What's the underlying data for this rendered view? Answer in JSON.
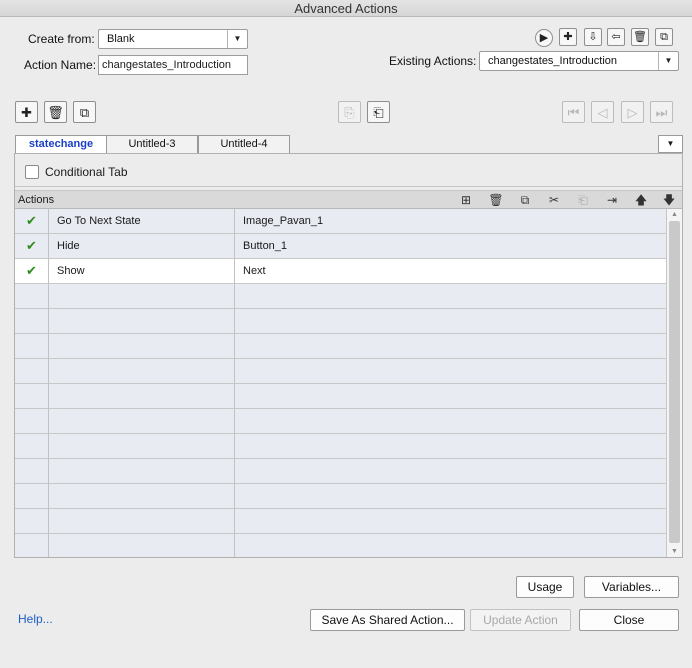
{
  "window": {
    "title": "Advanced Actions"
  },
  "form": {
    "create_from_label": "Create from:",
    "create_from_value": "Blank",
    "action_name_label": "Action Name:",
    "action_name_value": "changestates_Introduction",
    "existing_actions_label": "Existing Actions:",
    "existing_actions_value": "changestates_Introduction"
  },
  "tabs": [
    {
      "label": "statechange",
      "active": true
    },
    {
      "label": "Untitled-3",
      "active": false
    },
    {
      "label": "Untitled-4",
      "active": false
    }
  ],
  "conditional_tab": {
    "label": "Conditional Tab",
    "checked": false
  },
  "actions_table": {
    "header": "Actions",
    "rows": [
      {
        "status": "✔",
        "action": "Go To Next State",
        "target": "Image_Pavan_1"
      },
      {
        "status": "✔",
        "action": "Hide",
        "target": "Button_1"
      },
      {
        "status": "✔",
        "action": "Show",
        "target": "Next"
      }
    ],
    "empty_rows": 11,
    "selected_row": 2
  },
  "buttons": {
    "usage": "Usage",
    "variables": "Variables...",
    "save_shared": "Save As Shared Action...",
    "update_action": "Update Action",
    "close": "Close",
    "help": "Help..."
  },
  "colors": {
    "tab_active": "#1a3fc7",
    "check": "#2e8b1e",
    "link": "#1b5fc4",
    "grid_background": "#e8ebf2"
  }
}
